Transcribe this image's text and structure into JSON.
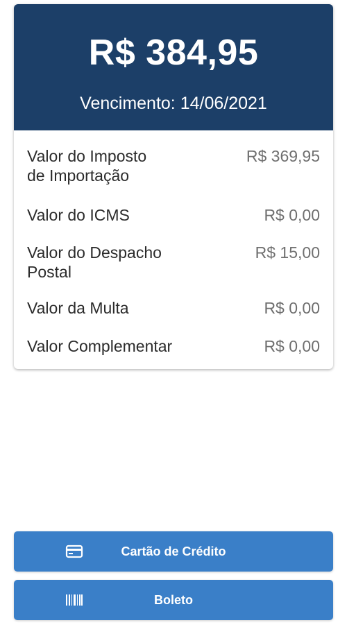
{
  "summary": {
    "total": "R$ 384,95",
    "due_date": "Vencimento: 14/06/2021"
  },
  "items": [
    {
      "label": "Valor do Imposto\nde Importação",
      "value": "R$ 369,95"
    },
    {
      "label": "Valor do ICMS",
      "value": "R$ 0,00"
    },
    {
      "label": "Valor do Despacho\nPostal",
      "value": "R$ 15,00"
    },
    {
      "label": "Valor da Multa",
      "value": "R$ 0,00"
    },
    {
      "label": "Valor Complementar",
      "value": "R$ 0,00"
    }
  ],
  "payment": {
    "credit_card": {
      "label": "Cartão de Crédito",
      "icon": "credit-card-icon"
    },
    "boleto": {
      "label": "Boleto",
      "icon": "barcode-icon"
    }
  },
  "colors": {
    "header": "#1c3f68",
    "button": "#3a7fc8",
    "value_text": "#6f6f6f"
  }
}
